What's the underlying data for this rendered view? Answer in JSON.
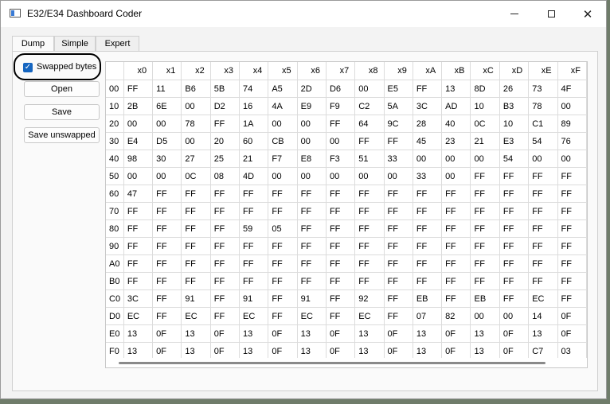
{
  "window": {
    "title": "E32/E34 Dashboard Coder"
  },
  "tabs": [
    {
      "label": "Dump"
    },
    {
      "label": "Simple"
    },
    {
      "label": "Expert"
    }
  ],
  "controls": {
    "swapped_label": "Swapped bytes",
    "swapped_checked": true,
    "open_label": "Open",
    "save_label": "Save",
    "save_unswapped_label": "Save unswapped"
  },
  "grid": {
    "columns": [
      "x0",
      "x1",
      "x2",
      "x3",
      "x4",
      "x5",
      "x6",
      "x7",
      "x8",
      "x9",
      "xA",
      "xB",
      "xC",
      "xD",
      "xE",
      "xF"
    ],
    "rows": [
      {
        "label": "00",
        "cells": [
          "FF",
          "11",
          "B6",
          "5B",
          "74",
          "A5",
          "2D",
          "D6",
          "00",
          "E5",
          "FF",
          "13",
          "8D",
          "26",
          "73",
          "4F"
        ]
      },
      {
        "label": "10",
        "cells": [
          "2B",
          "6E",
          "00",
          "D2",
          "16",
          "4A",
          "E9",
          "F9",
          "C2",
          "5A",
          "3C",
          "AD",
          "10",
          "B3",
          "78",
          "00"
        ]
      },
      {
        "label": "20",
        "cells": [
          "00",
          "00",
          "78",
          "FF",
          "1A",
          "00",
          "00",
          "FF",
          "64",
          "9C",
          "28",
          "40",
          "0C",
          "10",
          "C1",
          "89"
        ]
      },
      {
        "label": "30",
        "cells": [
          "E4",
          "D5",
          "00",
          "20",
          "60",
          "CB",
          "00",
          "00",
          "FF",
          "FF",
          "45",
          "23",
          "21",
          "E3",
          "54",
          "76"
        ]
      },
      {
        "label": "40",
        "cells": [
          "98",
          "30",
          "27",
          "25",
          "21",
          "F7",
          "E8",
          "F3",
          "51",
          "33",
          "00",
          "00",
          "00",
          "54",
          "00",
          "00"
        ]
      },
      {
        "label": "50",
        "cells": [
          "00",
          "00",
          "0C",
          "08",
          "4D",
          "00",
          "00",
          "00",
          "00",
          "00",
          "33",
          "00",
          "FF",
          "FF",
          "FF",
          "FF"
        ]
      },
      {
        "label": "60",
        "cells": [
          "47",
          "FF",
          "FF",
          "FF",
          "FF",
          "FF",
          "FF",
          "FF",
          "FF",
          "FF",
          "FF",
          "FF",
          "FF",
          "FF",
          "FF",
          "FF"
        ]
      },
      {
        "label": "70",
        "cells": [
          "FF",
          "FF",
          "FF",
          "FF",
          "FF",
          "FF",
          "FF",
          "FF",
          "FF",
          "FF",
          "FF",
          "FF",
          "FF",
          "FF",
          "FF",
          "FF"
        ]
      },
      {
        "label": "80",
        "cells": [
          "FF",
          "FF",
          "FF",
          "FF",
          "59",
          "05",
          "FF",
          "FF",
          "FF",
          "FF",
          "FF",
          "FF",
          "FF",
          "FF",
          "FF",
          "FF"
        ]
      },
      {
        "label": "90",
        "cells": [
          "FF",
          "FF",
          "FF",
          "FF",
          "FF",
          "FF",
          "FF",
          "FF",
          "FF",
          "FF",
          "FF",
          "FF",
          "FF",
          "FF",
          "FF",
          "FF"
        ]
      },
      {
        "label": "A0",
        "cells": [
          "FF",
          "FF",
          "FF",
          "FF",
          "FF",
          "FF",
          "FF",
          "FF",
          "FF",
          "FF",
          "FF",
          "FF",
          "FF",
          "FF",
          "FF",
          "FF"
        ]
      },
      {
        "label": "B0",
        "cells": [
          "FF",
          "FF",
          "FF",
          "FF",
          "FF",
          "FF",
          "FF",
          "FF",
          "FF",
          "FF",
          "FF",
          "FF",
          "FF",
          "FF",
          "FF",
          "FF"
        ]
      },
      {
        "label": "C0",
        "cells": [
          "3C",
          "FF",
          "91",
          "FF",
          "91",
          "FF",
          "91",
          "FF",
          "92",
          "FF",
          "EB",
          "FF",
          "EB",
          "FF",
          "EC",
          "FF"
        ]
      },
      {
        "label": "D0",
        "cells": [
          "EC",
          "FF",
          "EC",
          "FF",
          "EC",
          "FF",
          "EC",
          "FF",
          "EC",
          "FF",
          "07",
          "82",
          "00",
          "00",
          "14",
          "0F"
        ]
      },
      {
        "label": "E0",
        "cells": [
          "13",
          "0F",
          "13",
          "0F",
          "13",
          "0F",
          "13",
          "0F",
          "13",
          "0F",
          "13",
          "0F",
          "13",
          "0F",
          "13",
          "0F"
        ]
      },
      {
        "label": "F0",
        "cells": [
          "13",
          "0F",
          "13",
          "0F",
          "13",
          "0F",
          "13",
          "0F",
          "13",
          "0F",
          "13",
          "0F",
          "13",
          "0F",
          "C7",
          "03"
        ]
      }
    ]
  }
}
